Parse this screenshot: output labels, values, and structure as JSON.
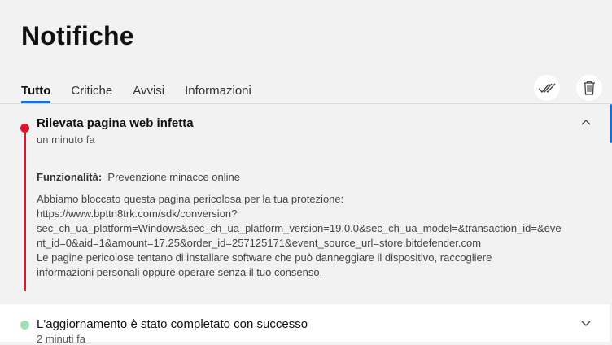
{
  "page": {
    "title": "Notifiche"
  },
  "tabs": [
    {
      "label": "Tutto",
      "active": true
    },
    {
      "label": "Critiche",
      "active": false
    },
    {
      "label": "Avvisi",
      "active": false
    },
    {
      "label": "Informazioni",
      "active": false
    }
  ],
  "toolbar": {
    "mark_all_read_icon": "double-check-icon",
    "delete_icon": "trash-icon"
  },
  "colors": {
    "accent": "#1a6fd6",
    "critical": "#e3132d",
    "success": "#9fe0b8"
  },
  "notifications": [
    {
      "title": "Rilevata pagina web infetta",
      "time": "un minuto fa",
      "status_color": "#e3132d",
      "expanded": true,
      "feature_label": "Funzionalità:",
      "feature_value": "Prevenzione minacce online",
      "message_lines": [
        "Abbiamo bloccato questa pagina pericolosa per la tua protezione:",
        "https://www.bpttn8trk.com/sdk/conversion?",
        "sec_ch_ua_platform=Windows&sec_ch_ua_platform_version=19.0.0&sec_ch_ua_model=&transaction_id=&eve",
        "nt_id=0&aid=1&amount=17.25&order_id=257125171&event_source_url=store.bitdefender.com",
        "Le pagine pericolose tentano di installare software che può danneggiare il dispositivo, raccogliere",
        "informazioni personali oppure operare senza il tuo consenso."
      ]
    },
    {
      "title": "L'aggiornamento è stato completato con successo",
      "time": "2 minuti fa",
      "status_color": "#9fe0b8",
      "expanded": false
    }
  ]
}
